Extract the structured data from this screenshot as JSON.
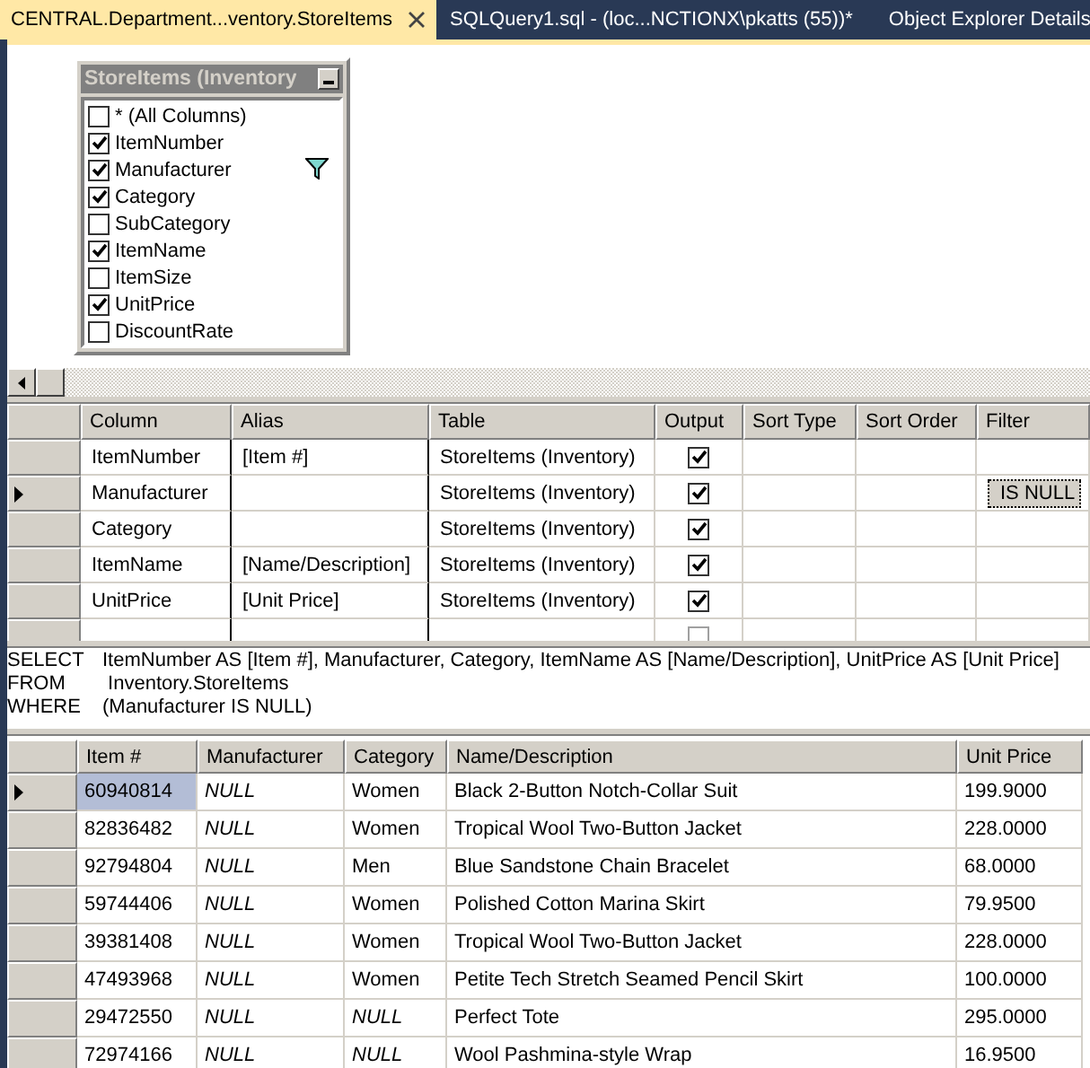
{
  "tabs": [
    {
      "label": "CENTRAL.Department...ventory.StoreItems",
      "selected": true,
      "closable": true
    },
    {
      "label": "SQLQuery1.sql - (loc...NCTIONX\\pkatts (55))*",
      "selected": false,
      "closable": false
    },
    {
      "label": "Object Explorer Details",
      "selected": false,
      "closable": false
    }
  ],
  "diagram_table": {
    "title": "StoreItems (Inventory",
    "columns": [
      {
        "name": "* (All Columns)",
        "checked": false,
        "filtered": false
      },
      {
        "name": "ItemNumber",
        "checked": true,
        "filtered": false
      },
      {
        "name": "Manufacturer",
        "checked": true,
        "filtered": true
      },
      {
        "name": "Category",
        "checked": true,
        "filtered": false
      },
      {
        "name": "SubCategory",
        "checked": false,
        "filtered": false
      },
      {
        "name": "ItemName",
        "checked": true,
        "filtered": false
      },
      {
        "name": "ItemSize",
        "checked": false,
        "filtered": false
      },
      {
        "name": "UnitPrice",
        "checked": true,
        "filtered": false
      },
      {
        "name": "DiscountRate",
        "checked": false,
        "filtered": false
      }
    ]
  },
  "criteria_grid": {
    "columns": [
      "Column",
      "Alias",
      "Table",
      "Output",
      "Sort Type",
      "Sort Order",
      "Filter"
    ],
    "rows": [
      {
        "column": "ItemNumber",
        "alias": "[Item #]",
        "table": "StoreItems (Inventory)",
        "output": true,
        "selected": false
      },
      {
        "column": "Manufacturer",
        "table": "StoreItems (Inventory)",
        "output": true,
        "filter": "IS NULL",
        "selected": true
      },
      {
        "column": "Category",
        "table": "StoreItems (Inventory)",
        "output": true,
        "selected": false
      },
      {
        "column": "ItemName",
        "alias": "[Name/Description]",
        "table": "StoreItems (Inventory)",
        "output": true,
        "selected": false
      },
      {
        "column": "UnitPrice",
        "alias": "[Unit Price]",
        "table": "StoreItems (Inventory)",
        "output": true,
        "selected": false
      }
    ]
  },
  "sql": [
    {
      "keyword": "SELECT",
      "text": "ItemNumber AS [Item #], Manufacturer, Category, ItemName AS [Name/Description], UnitPrice AS [Unit Price]"
    },
    {
      "keyword": "FROM",
      "text": " Inventory.StoreItems"
    },
    {
      "keyword": "WHERE",
      "text": "(Manufacturer IS NULL)"
    }
  ],
  "results": {
    "columns": [
      "Item #",
      "Manufacturer",
      "Category",
      "Name/Description",
      "Unit Price"
    ],
    "rows": [
      {
        "selected": true,
        "cells": [
          {
            "text": "60940814"
          },
          {
            "text": "NULL",
            "null": true
          },
          {
            "text": "Women"
          },
          {
            "text": "Black 2-Button Notch-Collar Suit"
          },
          {
            "text": "199.9000"
          }
        ]
      },
      {
        "selected": false,
        "cells": [
          {
            "text": "82836482"
          },
          {
            "text": "NULL",
            "null": true
          },
          {
            "text": "Women"
          },
          {
            "text": "Tropical Wool Two-Button Jacket"
          },
          {
            "text": "228.0000"
          }
        ]
      },
      {
        "selected": false,
        "cells": [
          {
            "text": "92794804"
          },
          {
            "text": "NULL",
            "null": true
          },
          {
            "text": "Men"
          },
          {
            "text": "Blue Sandstone Chain Bracelet"
          },
          {
            "text": "68.0000"
          }
        ]
      },
      {
        "selected": false,
        "cells": [
          {
            "text": "59744406"
          },
          {
            "text": "NULL",
            "null": true
          },
          {
            "text": "Women"
          },
          {
            "text": "Polished Cotton Marina Skirt"
          },
          {
            "text": "79.9500"
          }
        ]
      },
      {
        "selected": false,
        "cells": [
          {
            "text": "39381408"
          },
          {
            "text": "NULL",
            "null": true
          },
          {
            "text": "Women"
          },
          {
            "text": "Tropical Wool Two-Button Jacket"
          },
          {
            "text": "228.0000"
          }
        ]
      },
      {
        "selected": false,
        "cells": [
          {
            "text": "47493968"
          },
          {
            "text": "NULL",
            "null": true
          },
          {
            "text": "Women"
          },
          {
            "text": "Petite Tech Stretch Seamed Pencil Skirt"
          },
          {
            "text": "100.0000"
          }
        ]
      },
      {
        "selected": false,
        "cells": [
          {
            "text": "29472550"
          },
          {
            "text": "NULL",
            "null": true
          },
          {
            "text": "NULL",
            "null": true
          },
          {
            "text": "Perfect Tote"
          },
          {
            "text": "295.0000"
          }
        ]
      },
      {
        "selected": false,
        "cells": [
          {
            "text": "72974166"
          },
          {
            "text": "NULL",
            "null": true
          },
          {
            "text": "NULL",
            "null": true
          },
          {
            "text": "Wool Pashmina-style Wrap"
          },
          {
            "text": "16.9500"
          }
        ]
      }
    ]
  }
}
